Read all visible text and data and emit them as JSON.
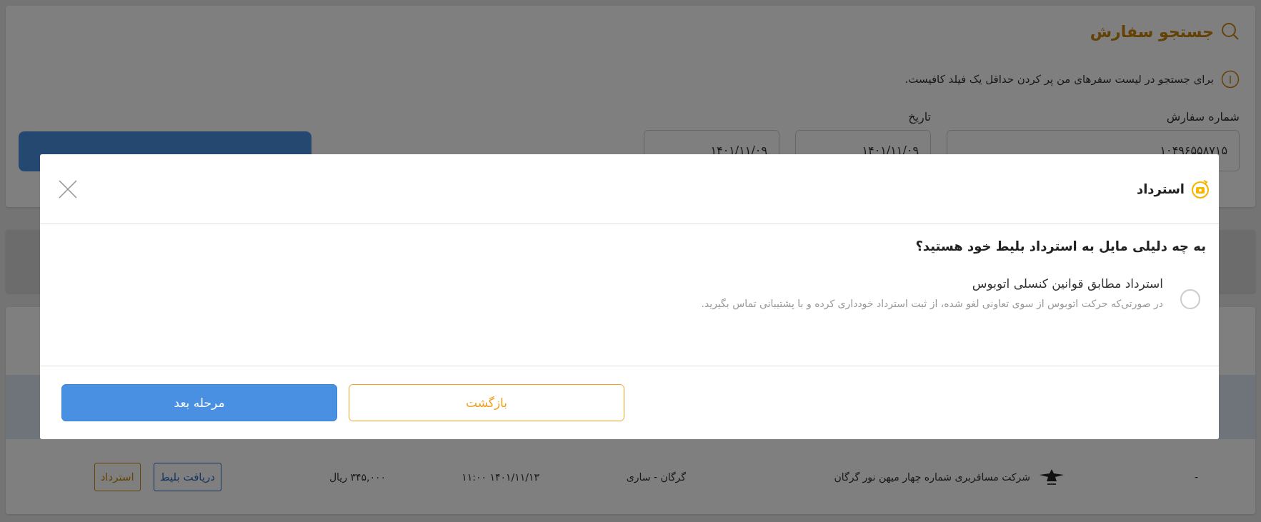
{
  "search_panel": {
    "title": "جستجو سفارش",
    "info": "برای جستجو در لیست سفرهای من پر کردن حداقل یک فیلد کافیست.",
    "fields": [
      {
        "label": "شماره سفارش",
        "value": "۱۰۴۹۶۵۵۸۷۱۵"
      },
      {
        "label": "تاریخ",
        "value": "۱۴۰۱/۱۱/۰۹"
      },
      {
        "value": "۱۴۰۱/۱۱/۰۹"
      }
    ]
  },
  "trips": {
    "rows": [
      {
        "column_1": "-",
        "company": "شرکت مسافربری شماره چهار میهن نور گرگان",
        "route": "گرگان - ساری",
        "date": "۱۴۰۱/۱۱/۱۳",
        "time": "۱۱:۰۰",
        "price": "۳۴۵,۰۰۰ ریال",
        "actions": [
          {
            "label": "دریافت بلیط",
            "kind": "ticket"
          },
          {
            "label": "استرداد",
            "kind": "refund"
          }
        ]
      }
    ]
  },
  "modal": {
    "title": "استرداد",
    "question": "به چه دلیلی مایل به استرداد بلیط خود هستید؟",
    "options": [
      {
        "label": "استرداد مطابق قوانین کنسلی اتوبوس",
        "description": "در صورتی‌که حرکت اتوبوس از سوی تعاونی لغو شده، از ثبت استرداد خودداری کرده و با پشتیبانی تماس بگیرید.",
        "selected": false
      }
    ],
    "buttons": [
      {
        "label": "بازگشت",
        "kind": "secondary"
      },
      {
        "label": "مرحله بعد",
        "kind": "primary"
      }
    ]
  }
}
